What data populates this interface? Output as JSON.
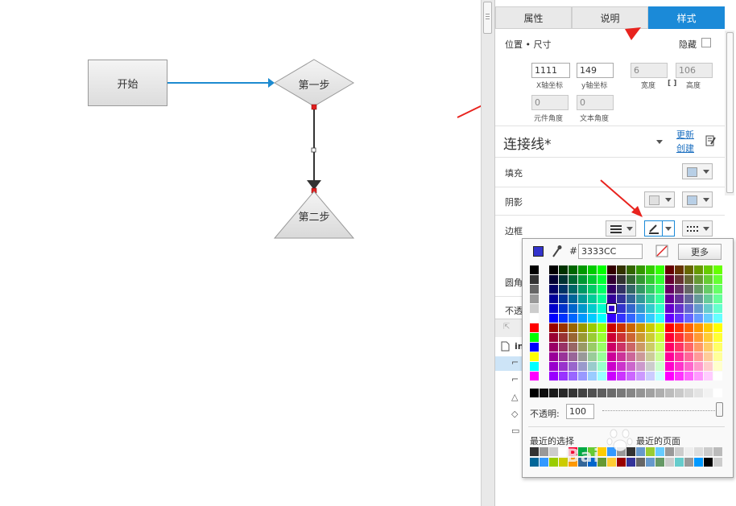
{
  "canvas": {
    "start_label": "开始",
    "step1_label": "第一步",
    "step2_label": "第二步"
  },
  "tabs": [
    {
      "label": "属性",
      "active": false
    },
    {
      "label": "说明",
      "active": false
    },
    {
      "label": "样式",
      "active": true
    }
  ],
  "position": {
    "title": "位置 • 尺寸",
    "hidden_label": "隐藏",
    "x_value": "1111",
    "x_label": "X轴坐标",
    "y_value": "149",
    "y_label": "y轴坐标",
    "width_value": "6",
    "width_label": "宽度",
    "height_value": "106",
    "height_label": "高度",
    "element_angle_value": "0",
    "element_angle_label": "元件角度",
    "text_angle_value": "0",
    "text_angle_label": "文本角度"
  },
  "style": {
    "name": "连接线*",
    "update_link": "更新",
    "create_link": "创建",
    "fill_label": "填充",
    "shadow_label": "阴影",
    "border_label": "边框",
    "corner_label": "圆角",
    "opacity_row_label": "不透"
  },
  "tree": {
    "page_label": "in"
  },
  "color_picker": {
    "hash": "#",
    "hex_value": "3333CC",
    "more_button": "更多",
    "opacity_label": "不透明:",
    "opacity_value": "100",
    "opacity_level": 1.0,
    "recent_selection_label": "最近的选择",
    "recent_pages_label": "最近的页面",
    "current_color": "#3333CC",
    "accent": "#1b8ad8"
  },
  "watermark": "Bai",
  "icons": [
    "eyedropper-icon",
    "no-color-icon",
    "page-icon",
    "chevron-down-icon",
    "edit-icon",
    "pen-icon"
  ]
}
